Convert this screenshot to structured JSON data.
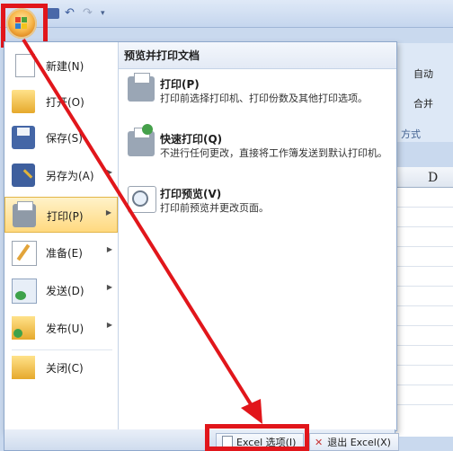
{
  "titlebar": {
    "undo_glyph": "↶",
    "redo_glyph": "↷",
    "dropdown_glyph": "▾"
  },
  "ribbon": {
    "auto_label": "自动",
    "merge_label": "合并",
    "group_label": "方式",
    "col_d": "D"
  },
  "menu": {
    "items": [
      {
        "label": "新建(N)",
        "icon": "new-document-icon",
        "has_submenu": false
      },
      {
        "label": "打开(O)",
        "icon": "open-folder-icon",
        "has_submenu": false
      },
      {
        "label": "保存(S)",
        "icon": "save-disk-icon",
        "has_submenu": false
      },
      {
        "label": "另存为(A)",
        "icon": "save-as-icon",
        "has_submenu": true
      },
      {
        "label": "打印(P)",
        "icon": "printer-icon",
        "has_submenu": true,
        "active": true
      },
      {
        "label": "准备(E)",
        "icon": "prepare-icon",
        "has_submenu": true
      },
      {
        "label": "发送(D)",
        "icon": "send-icon",
        "has_submenu": true
      },
      {
        "label": "发布(U)",
        "icon": "publish-icon",
        "has_submenu": true
      },
      {
        "label": "关闭(C)",
        "icon": "close-folder-icon",
        "has_submenu": false
      }
    ],
    "submenu_arrow": "▶"
  },
  "print_pane": {
    "title": "预览并打印文档",
    "items": [
      {
        "name": "打印(P)",
        "desc": "打印前选择打印机、打印份数及其他打印选项。"
      },
      {
        "name": "快速打印(Q)",
        "desc": "不进行任何更改，直接将工作簿发送到默认打印机。"
      },
      {
        "name": "打印预览(V)",
        "desc": "打印前预览并更改页面。"
      }
    ]
  },
  "bottom": {
    "options_label": "Excel 选项(I)",
    "exit_label": "退出 Excel(X)",
    "exit_glyph": "✕"
  },
  "colors": {
    "annotation": "#e1161b",
    "active_item": "#ffd97f"
  }
}
